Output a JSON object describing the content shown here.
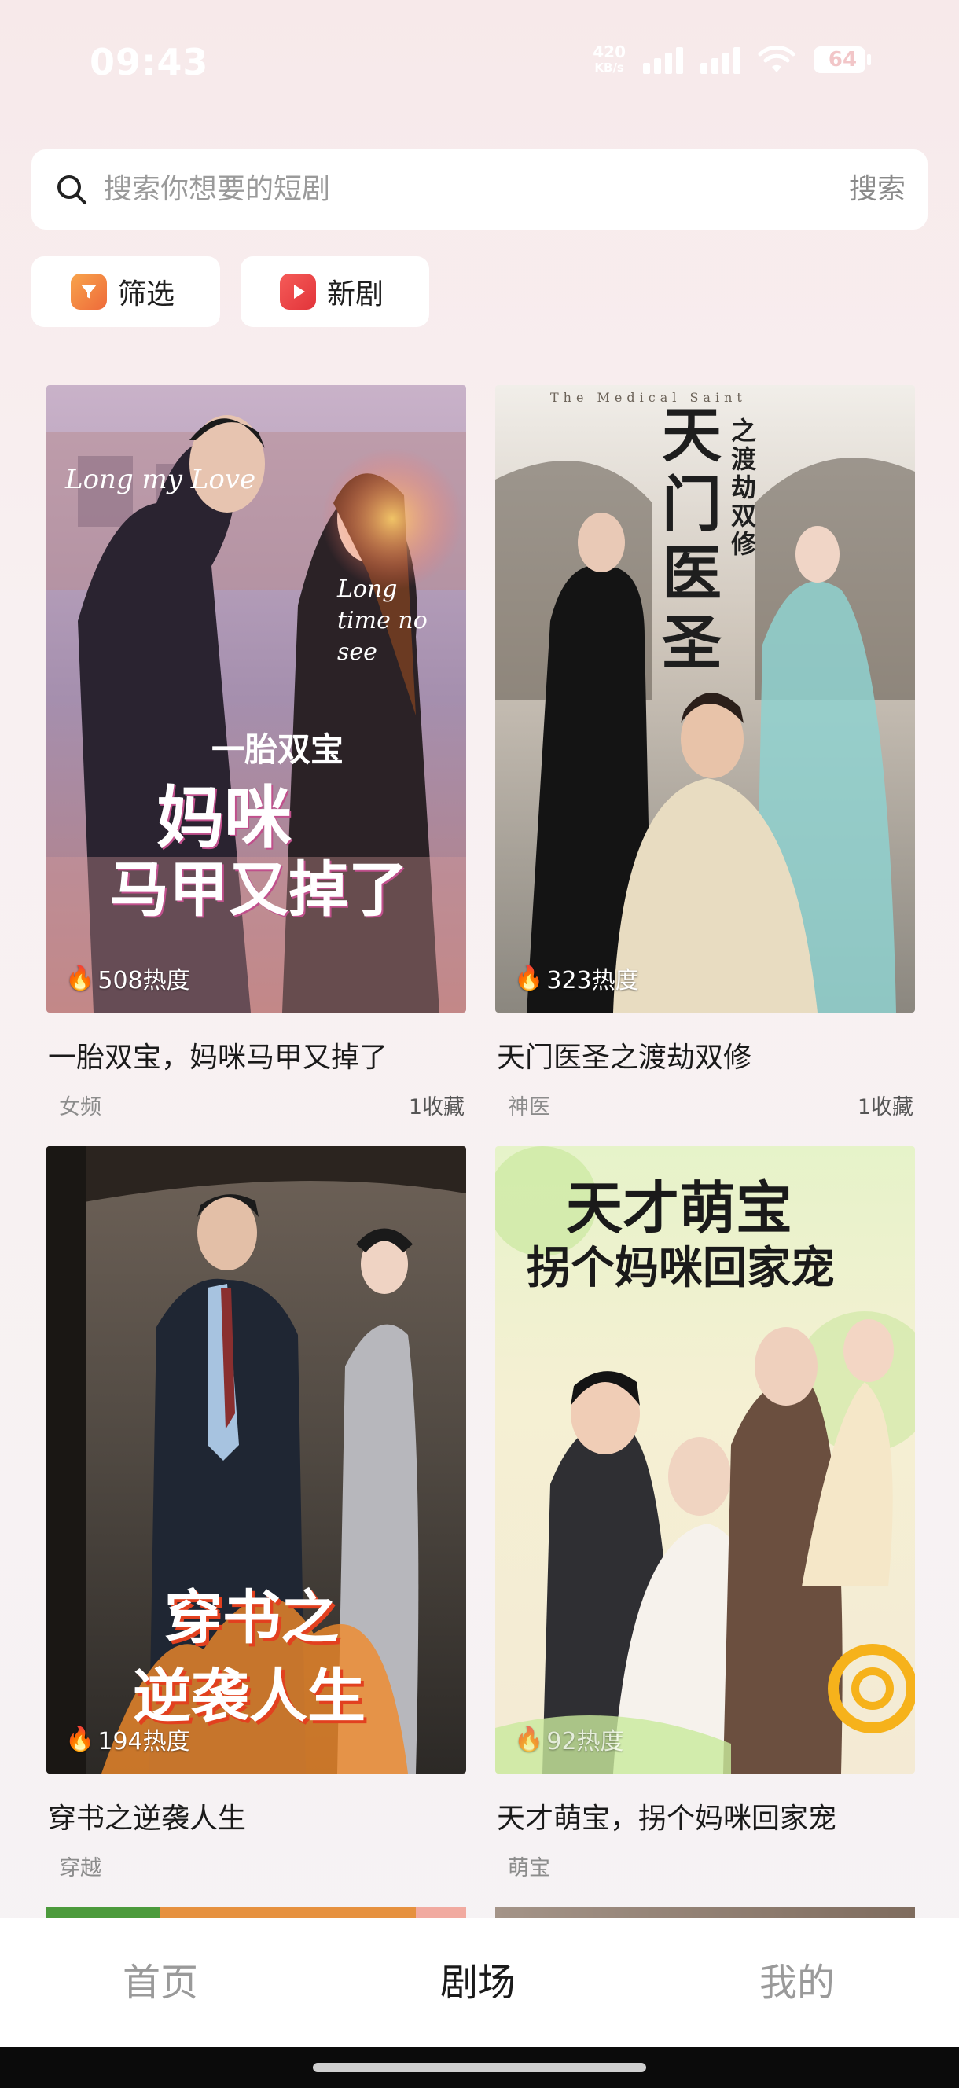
{
  "status_bar": {
    "time": "09:43",
    "net_speed": "420",
    "net_speed_unit": "KB/s",
    "battery": "64"
  },
  "search": {
    "placeholder": "搜索你想要的短剧",
    "button": "搜索"
  },
  "chips": [
    {
      "label": "筛选",
      "icon": "filter-icon"
    },
    {
      "label": "新剧",
      "icon": "play-icon"
    }
  ],
  "dramas": [
    {
      "title": "一胎双宝，妈咪马甲又掉了",
      "tag": "女频",
      "heat": "508热度",
      "favorites": "1收藏",
      "poster_text": [
        "一胎双宝",
        "妈咪",
        "马甲又掉了"
      ],
      "poster_script": [
        "Long my Love",
        "Long time no see"
      ]
    },
    {
      "title": "天门医圣之渡劫双修",
      "tag": "神医",
      "heat": "323热度",
      "favorites": "1收藏",
      "poster_text": [
        "天门医圣",
        "之渡劫双修"
      ],
      "poster_script": [
        "The Medical Saint"
      ]
    },
    {
      "title": "穿书之逆袭人生",
      "tag": "穿越",
      "heat": "194热度",
      "favorites": "",
      "poster_text": [
        "穿书之",
        "逆袭人生"
      ]
    },
    {
      "title": "天才萌宝，拐个妈咪回家宠",
      "tag": "萌宝",
      "heat": "92热度",
      "favorites": "",
      "poster_text": [
        "天才萌宝",
        "拐个妈咪回家宠"
      ]
    }
  ],
  "bottom_nav": {
    "items": [
      "首页",
      "剧场",
      "我的"
    ],
    "active": "剧场"
  }
}
